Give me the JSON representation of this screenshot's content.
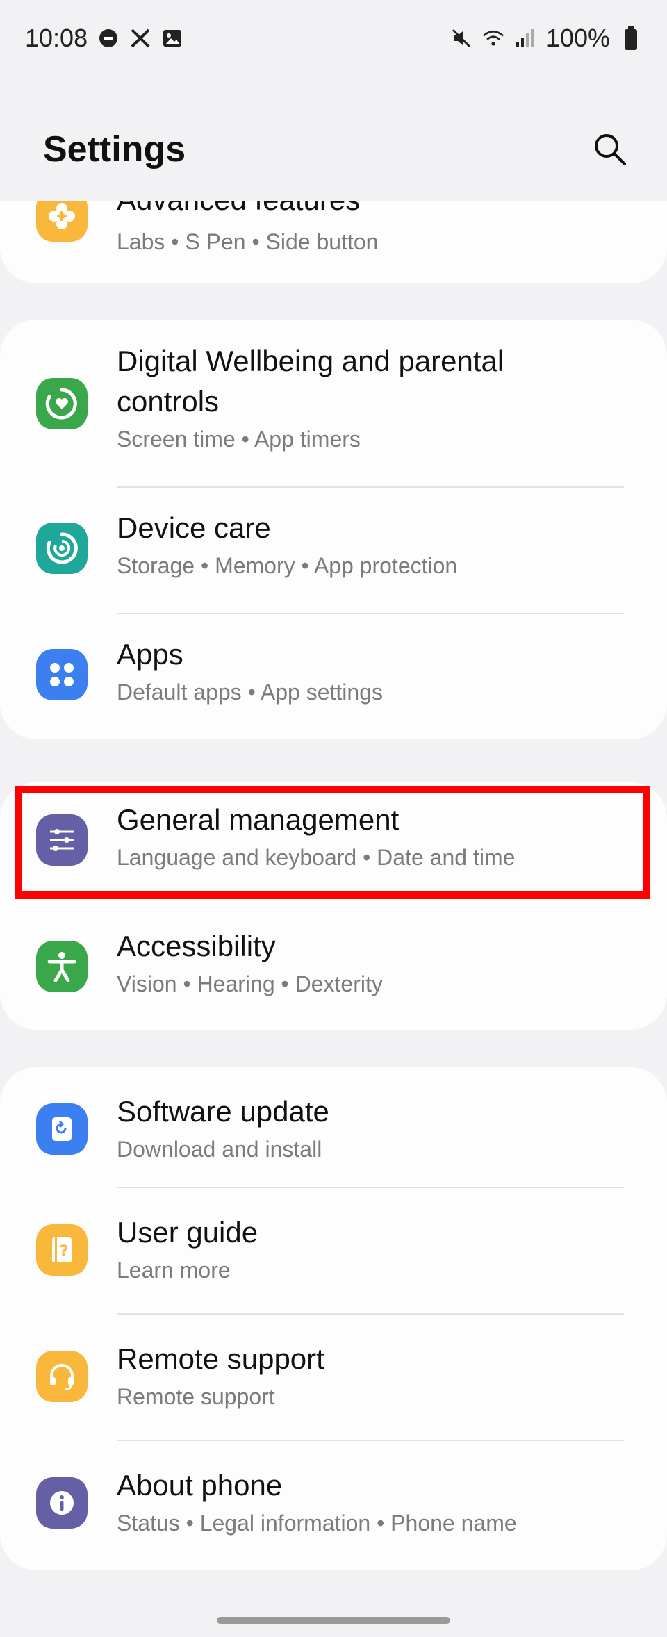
{
  "status_bar": {
    "time": "10:08",
    "battery": "100%"
  },
  "header": {
    "title": "Settings"
  },
  "items": {
    "advanced_features": {
      "title": "Advanced features",
      "subtitle": "Labs  •  S Pen  •  Side button",
      "color": "#f9b83c"
    },
    "digital_wellbeing": {
      "title_line1": "Digital Wellbeing and parental",
      "title_line2": "controls",
      "subtitle": "Screen time  •  App timers",
      "color": "#3aa84a"
    },
    "device_care": {
      "title": "Device care",
      "subtitle": "Storage  •  Memory  •  App protection",
      "color": "#1fa89a"
    },
    "apps": {
      "title": "Apps",
      "subtitle": "Default apps  •  App settings",
      "color": "#3b7ff0"
    },
    "general_management": {
      "title": "General management",
      "subtitle": "Language and keyboard  •  Date and time",
      "color": "#6560a6"
    },
    "accessibility": {
      "title": "Accessibility",
      "subtitle": "Vision  •  Hearing  •  Dexterity",
      "color": "#3aa84a"
    },
    "software_update": {
      "title": "Software update",
      "subtitle": "Download and install",
      "color": "#3b7ff0"
    },
    "user_guide": {
      "title": "User guide",
      "subtitle": "Learn more",
      "color": "#f9b83c"
    },
    "remote_support": {
      "title": "Remote support",
      "subtitle": "Remote support",
      "color": "#f9b83c"
    },
    "about_phone": {
      "title": "About phone",
      "subtitle": "Status  •  Legal information  •  Phone name",
      "color": "#6560a6"
    }
  },
  "colors": {
    "background": "#f2f2f4",
    "card": "#fdfdfd",
    "highlight": "#ff0000"
  }
}
